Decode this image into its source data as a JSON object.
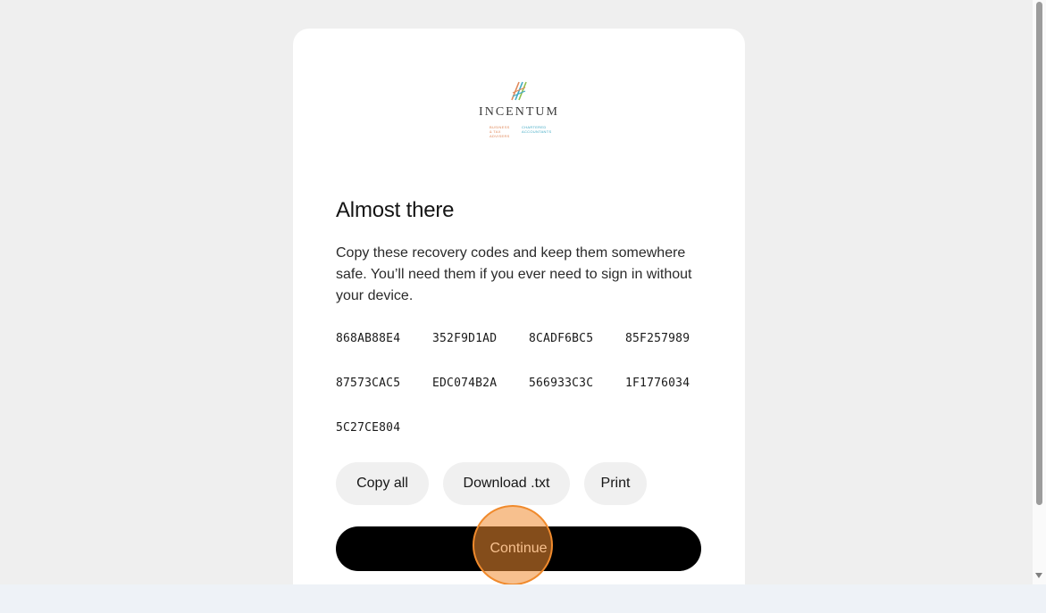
{
  "brand": {
    "name": "INCENTUM",
    "tagline_left": "BUSINESS & TAX ADVISERS",
    "tagline_right": "CHARTERED ACCOUNTANTS",
    "colors": {
      "orange": "#e0895a",
      "teal": "#3fa9c4",
      "green": "#8fbf4d"
    }
  },
  "page": {
    "title": "Almost there",
    "description": "Copy these recovery codes and keep them somewhere safe. You’ll need them if you ever need to sign in without your device."
  },
  "codes": [
    "868AB88E4",
    "352F9D1AD",
    "8CADF6BC5",
    "85F257989",
    "87573CAC5",
    "EDC074B2A",
    "566933C3C",
    "1F1776034",
    "5C27CE804"
  ],
  "actions": {
    "copy_all": "Copy all",
    "download": "Download .txt",
    "print": "Print",
    "continue": "Continue"
  },
  "highlight": {
    "color": "#f08a2c"
  }
}
